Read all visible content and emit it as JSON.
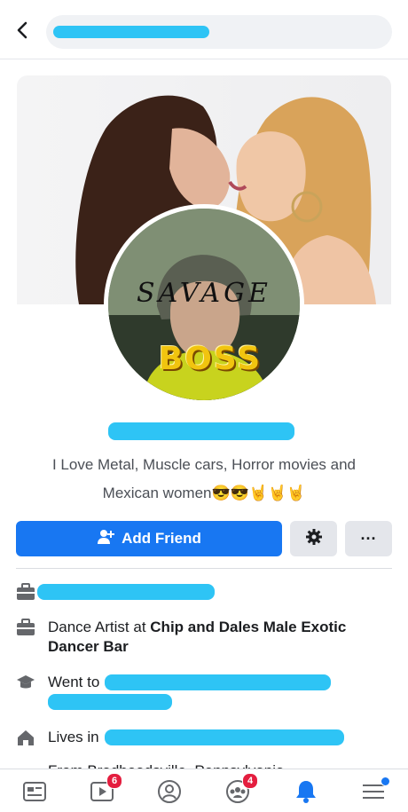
{
  "bio": {
    "line1": "I Love Metal, Muscle cars, Horror movies and",
    "line2": "Mexican women😎😎🤘🤘🤘"
  },
  "avatar_overlay": {
    "top_text": "SAVAGE",
    "bottom_text": "BOSS"
  },
  "actions": {
    "add_friend_label": "Add Friend",
    "more_label": "···"
  },
  "about": {
    "work_prefix": "Dance Artist at ",
    "work_place": "Chip and Dales Male Exotic Dancer Bar",
    "education_prefix": "Went to ",
    "lives_prefix": "Lives in",
    "from_partial": "From Bradbeadsville, Pennsylvania"
  },
  "bottom_nav": {
    "watch_badge": "6",
    "groups_badge": "4"
  },
  "colors": {
    "accent": "#1877f2",
    "badge": "#e41e3f",
    "redaction": "#2ec4f5"
  }
}
